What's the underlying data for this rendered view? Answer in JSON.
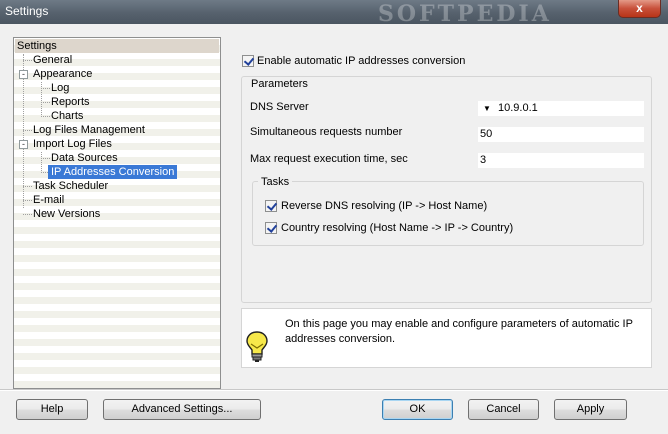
{
  "window": {
    "title": "Settings",
    "watermark": "SOFTPEDIA",
    "close_glyph": "x"
  },
  "tree": {
    "root": "Settings",
    "items": [
      {
        "label": "General"
      },
      {
        "label": "Appearance",
        "expanded": true
      },
      {
        "label": "Log"
      },
      {
        "label": "Reports"
      },
      {
        "label": "Charts"
      },
      {
        "label": "Log Files Management"
      },
      {
        "label": "Import Log Files",
        "expanded": true
      },
      {
        "label": "Data Sources"
      },
      {
        "label": "IP Addresses Conversion",
        "selected": true
      },
      {
        "label": "Task Scheduler"
      },
      {
        "label": "E-mail"
      },
      {
        "label": "New Versions"
      }
    ],
    "expander_glyph": "-"
  },
  "main": {
    "enable_checkbox": {
      "label": "Enable automatic IP addresses conversion",
      "checked": true
    },
    "parameters": {
      "title": "Parameters",
      "dns_server": {
        "label": "DNS Server",
        "value": "10.9.0.1"
      },
      "simultaneous": {
        "label": "Simultaneous requests number",
        "value": "50"
      },
      "max_time": {
        "label": "Max request execution time, sec",
        "value": "3"
      }
    },
    "tasks": {
      "title": "Tasks",
      "reverse_dns": {
        "label": "Reverse DNS resolving (IP -> Host Name)",
        "checked": true
      },
      "country": {
        "label": "Country resolving (Host Name -> IP -> Country)",
        "checked": true
      }
    },
    "help_text": "On this page you may enable and configure parameters of automatic IP addresses conversion."
  },
  "buttons": {
    "help": "Help",
    "advanced": "Advanced Settings...",
    "ok": "OK",
    "cancel": "Cancel",
    "apply": "Apply"
  },
  "colors": {
    "selection": "#3a79d6",
    "titlebar": "#56616d",
    "close": "#c8503a"
  }
}
